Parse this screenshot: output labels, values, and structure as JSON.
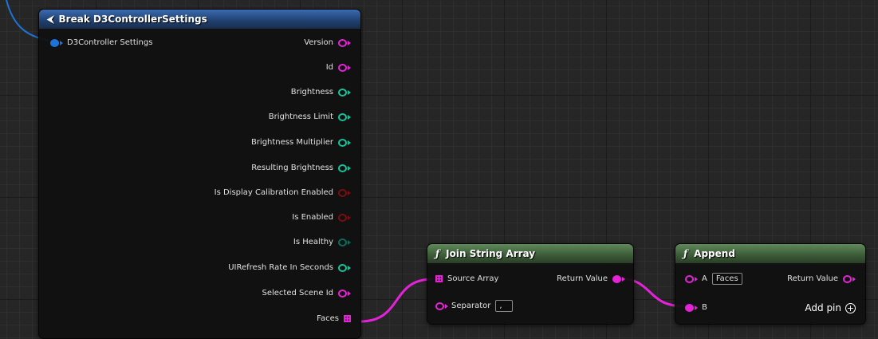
{
  "colors": {
    "pink": "#e622d8",
    "teal": "#17c29a",
    "red": "#7a0e0e",
    "blue": "#1e73d8",
    "teal_dim": "#0e6b5a"
  },
  "break_node": {
    "title": "Break D3ControllerSettings",
    "title_icon": "break-struct-icon",
    "input": "D3Controller Settings",
    "outputs": [
      {
        "label": "Version",
        "pin": "pink",
        "kind": "hollow"
      },
      {
        "label": "Id",
        "pin": "pink",
        "kind": "hollow"
      },
      {
        "label": "Brightness",
        "pin": "teal",
        "kind": "hollow"
      },
      {
        "label": "Brightness Limit",
        "pin": "teal",
        "kind": "hollow"
      },
      {
        "label": "Brightness Multiplier",
        "pin": "teal",
        "kind": "hollow"
      },
      {
        "label": "Resulting Brightness",
        "pin": "teal",
        "kind": "hollow"
      },
      {
        "label": "Is Display Calibration Enabled",
        "pin": "red",
        "kind": "hollow"
      },
      {
        "label": "Is Enabled",
        "pin": "red",
        "kind": "hollow"
      },
      {
        "label": "Is Healthy",
        "pin": "teal_dim",
        "kind": "hollow"
      },
      {
        "label": "UIRefresh Rate In Seconds",
        "pin": "teal",
        "kind": "hollow"
      },
      {
        "label": "Selected Scene Id",
        "pin": "pink",
        "kind": "hollow"
      },
      {
        "label": "Faces",
        "pin": "pink",
        "kind": "array"
      }
    ]
  },
  "join_node": {
    "title": "Join String Array",
    "title_icon": "function-icon",
    "source_array": "Source Array",
    "separator": "Separator",
    "separator_value": ",",
    "return_value": "Return Value"
  },
  "append_node": {
    "title": "Append",
    "title_icon": "function-icon",
    "a_label": "A",
    "a_value": "Faces",
    "b_label": "B",
    "return_value": "Return Value",
    "add_pin": "Add pin"
  }
}
